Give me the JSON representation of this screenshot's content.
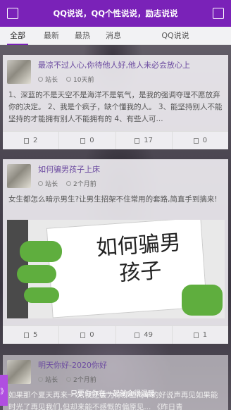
{
  "header": {
    "title": "QQ说说，QQ个性说说，励志说说"
  },
  "tabs": [
    {
      "label": "全部",
      "active": true
    },
    {
      "label": "最新"
    },
    {
      "label": "最热"
    },
    {
      "label": "消息"
    },
    {
      "label": "QQ说说"
    }
  ],
  "posts": [
    {
      "title": "最凉不过人心,你待他人好,他人未必会放心上",
      "author": "站长",
      "time": "10天前",
      "excerpt": "1、深蓝的不是天空不是海洋不是氧气，是我的强调夺理不愿放弃你的决定。 2、我是个疯子，缺个懂我的人。 3、能坚持别人不能坚持的才能拥有别人不能拥有的 4、有些人可...",
      "stats": [
        "2",
        "0",
        "17",
        "0"
      ]
    },
    {
      "title": "如何骗男孩子上床",
      "author": "站长",
      "time": "2个月前",
      "excerpt": "女生都怎么暗示男生?让男生招架不住常用的套路,简直手到擒来!",
      "image_text": "如何骗男孩子",
      "stats": [
        "5",
        "0",
        "49",
        "1"
      ]
    },
    {
      "title": "明天你好-2020你好",
      "author": "站长",
      "time": "2个月前",
      "excerpt": "如果那个夏天再来一次,我还会为你那些简单的好说声再见如果能时光了再见我们,但却来能不感慨的偏原见... 《昨日青"
    }
  ],
  "overlay_caption": "只要你你在一起就会很温暖",
  "side_tab": "》"
}
